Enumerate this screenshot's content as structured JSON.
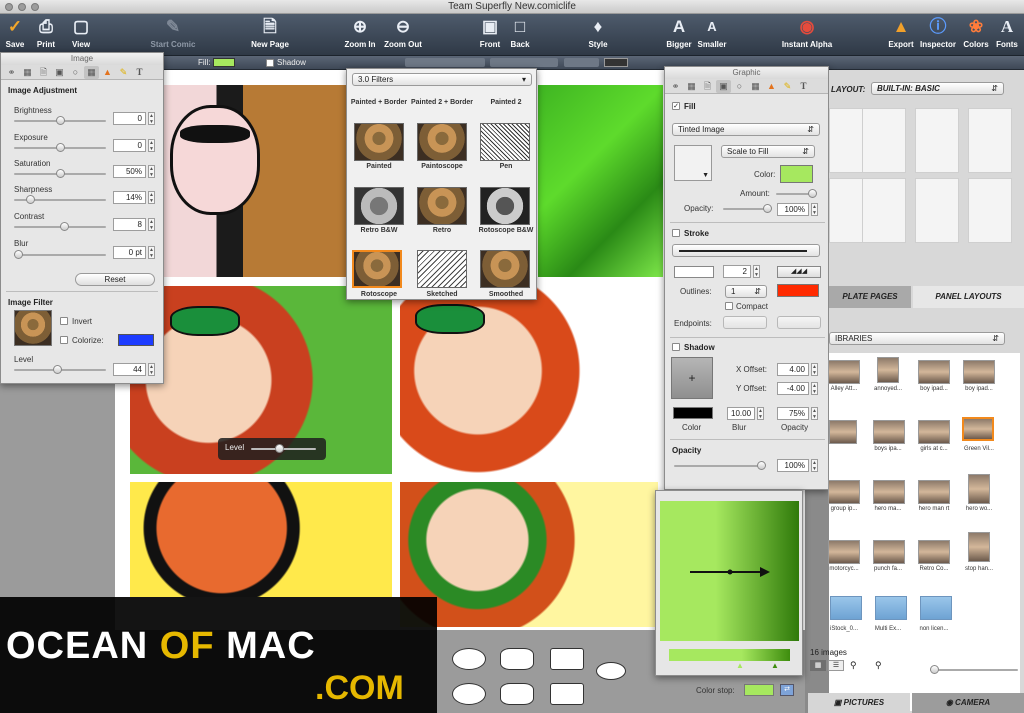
{
  "window": {
    "title": "Team Superfly New.comiclife"
  },
  "toolbar": {
    "save": "Save",
    "print": "Print",
    "view": "View",
    "start_comic": "Start Comic",
    "new_page": "New Page",
    "zoom_in": "Zoom In",
    "zoom_out": "Zoom Out",
    "front": "Front",
    "back": "Back",
    "style": "Style",
    "bigger": "Bigger",
    "smaller": "Smaller",
    "instant_alpha": "Instant Alpha",
    "export": "Export",
    "inspector": "Inspector",
    "colors": "Colors",
    "fonts": "Fonts"
  },
  "format_bar": {
    "fill_label": "Fill:",
    "shadow_label": "Shadow"
  },
  "image_panel": {
    "title": "Image",
    "section_adjust": "Image Adjustment",
    "brightness": {
      "label": "Brightness",
      "value": "0",
      "level": 0.5
    },
    "exposure": {
      "label": "Exposure",
      "value": "0",
      "level": 0.5
    },
    "saturation": {
      "label": "Saturation",
      "value": "50%",
      "level": 0.5
    },
    "sharpness": {
      "label": "Sharpness",
      "value": "14%",
      "level": 0.14
    },
    "contrast": {
      "label": "Contrast",
      "value": "8",
      "level": 0.54
    },
    "blur": {
      "label": "Blur",
      "value": "0 pt",
      "level": 0.0
    },
    "reset": "Reset",
    "section_filter": "Image Filter",
    "invert": "Invert",
    "colorize": "Colorize:",
    "colorize_color": "#1d3cff",
    "level": {
      "label": "Level",
      "value": "44",
      "level": 0.44
    }
  },
  "filters_panel": {
    "dropdown": "3.0 Filters",
    "row0": [
      "Painted + Border",
      "Painted 2 + Border",
      "Painted 2"
    ],
    "row1": [
      "Painted",
      "Paintoscope",
      "Pen"
    ],
    "row2": [
      "Retro B&W",
      "Retro",
      "Rotoscope B&W"
    ],
    "row3": [
      "Rotoscope",
      "Sketched",
      "Smoothed"
    ]
  },
  "graphic_panel": {
    "title": "Graphic",
    "fill_label": "Fill",
    "fill_type": "Tinted Image",
    "scale": "Scale to Fill",
    "color_label": "Color:",
    "fill_color": "#a6e85f",
    "amount_label": "Amount:",
    "amount_level": 0.85,
    "opacity_label": "Opacity:",
    "opacity_value": "100%",
    "stroke_label": "Stroke",
    "stroke_width": "2",
    "outlines_label": "Outlines:",
    "outlines_value": "1",
    "outline_color": "#ff2a00",
    "compact_label": "Compact",
    "endpoints_label": "Endpoints:",
    "shadow_label": "Shadow",
    "x_offset_label": "X Offset:",
    "x_offset": "4.00",
    "y_offset_label": "Y Offset:",
    "y_offset": "-4.00",
    "color_cap": "Color",
    "blur_cap": "Blur",
    "blur_value": "10.00",
    "opacity_cap": "Opacity",
    "shadow_opacity": "75%",
    "opacity_section": "Opacity",
    "opacity_section_value": "100%"
  },
  "gradient_panel": {
    "color_stop_label": "Color stop:",
    "stop_color": "#a6e85f"
  },
  "canvas": {
    "level_hud": "Level"
  },
  "right_sidebar": {
    "layout_label": "LAYOUT:",
    "layout_value": "BUILT-IN: BASIC",
    "tab_templates": "PLATE PAGES",
    "tab_panels": "PANEL LAYOUTS",
    "libraries": "IBRARIES",
    "images": [
      "Alley Att...",
      "annoyed...",
      "boy ipad...",
      "boy ipad...",
      "",
      "boys ipa...",
      "girls at c...",
      "Green Vil...",
      "group ip...",
      "hero ma...",
      "hero man rt",
      "hero wo...",
      "motorcyc...",
      "punch fa...",
      "Retro Co...",
      "stop han...",
      "iStock_0...",
      "Multi Ex...",
      "non licen..."
    ],
    "count": "16 images",
    "tab_pictures": "PICTURES",
    "tab_camera": "CAMERA"
  },
  "watermark": {
    "line1_a": "OCEAN",
    "line1_b": "OF",
    "line1_c": "MAC",
    "line2": ".COM"
  }
}
